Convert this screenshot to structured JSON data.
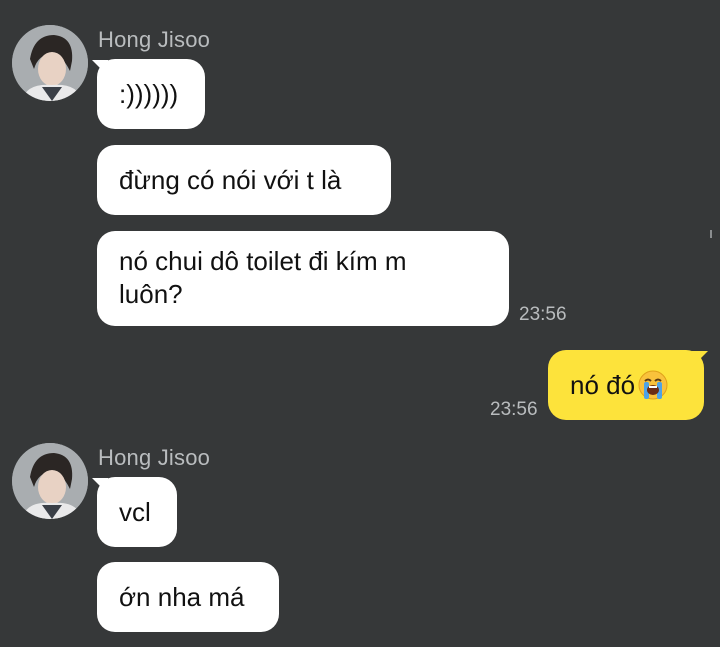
{
  "chat": {
    "groups": [
      {
        "sender": "Hong Jisoo",
        "messages": [
          ":))))))",
          "đừng có nói với t là",
          "nó chui dô toilet đi kím m\nluôn?"
        ],
        "time": "23:56"
      },
      {
        "own_message": "nó đó",
        "own_emoji": "loudly-crying-face-emoji",
        "time": "23:56"
      },
      {
        "sender": "Hong Jisoo",
        "messages": [
          "vcl",
          "ớn nha má"
        ]
      }
    ]
  },
  "colors": {
    "background": "#363839",
    "incoming_bubble": "#ffffff",
    "outgoing_bubble": "#fde33b",
    "meta_text": "#b9bcbe"
  }
}
